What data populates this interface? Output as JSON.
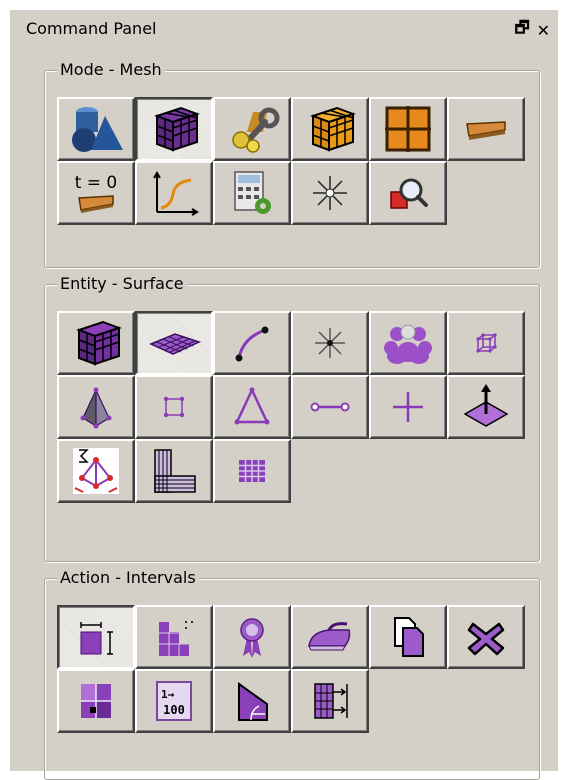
{
  "panel": {
    "title": "Command Panel",
    "restore_glyph": "🗗",
    "close_glyph": "✕"
  },
  "groups": {
    "mode": {
      "title": "Mode - Mesh"
    },
    "entity": {
      "title": "Entity - Surface"
    },
    "action": {
      "title": "Action - Intervals"
    }
  },
  "mode_icons": {
    "t0_label": "t = 0"
  },
  "action_icons": {
    "map_label_1": "1→",
    "map_label_2": "100"
  },
  "colors": {
    "panel_bg": "#d4d0c8",
    "purple": "#9b4fc9",
    "dark_purple": "#4b1d6b",
    "orange": "#e69b1e",
    "navy": "#1f3f74"
  }
}
